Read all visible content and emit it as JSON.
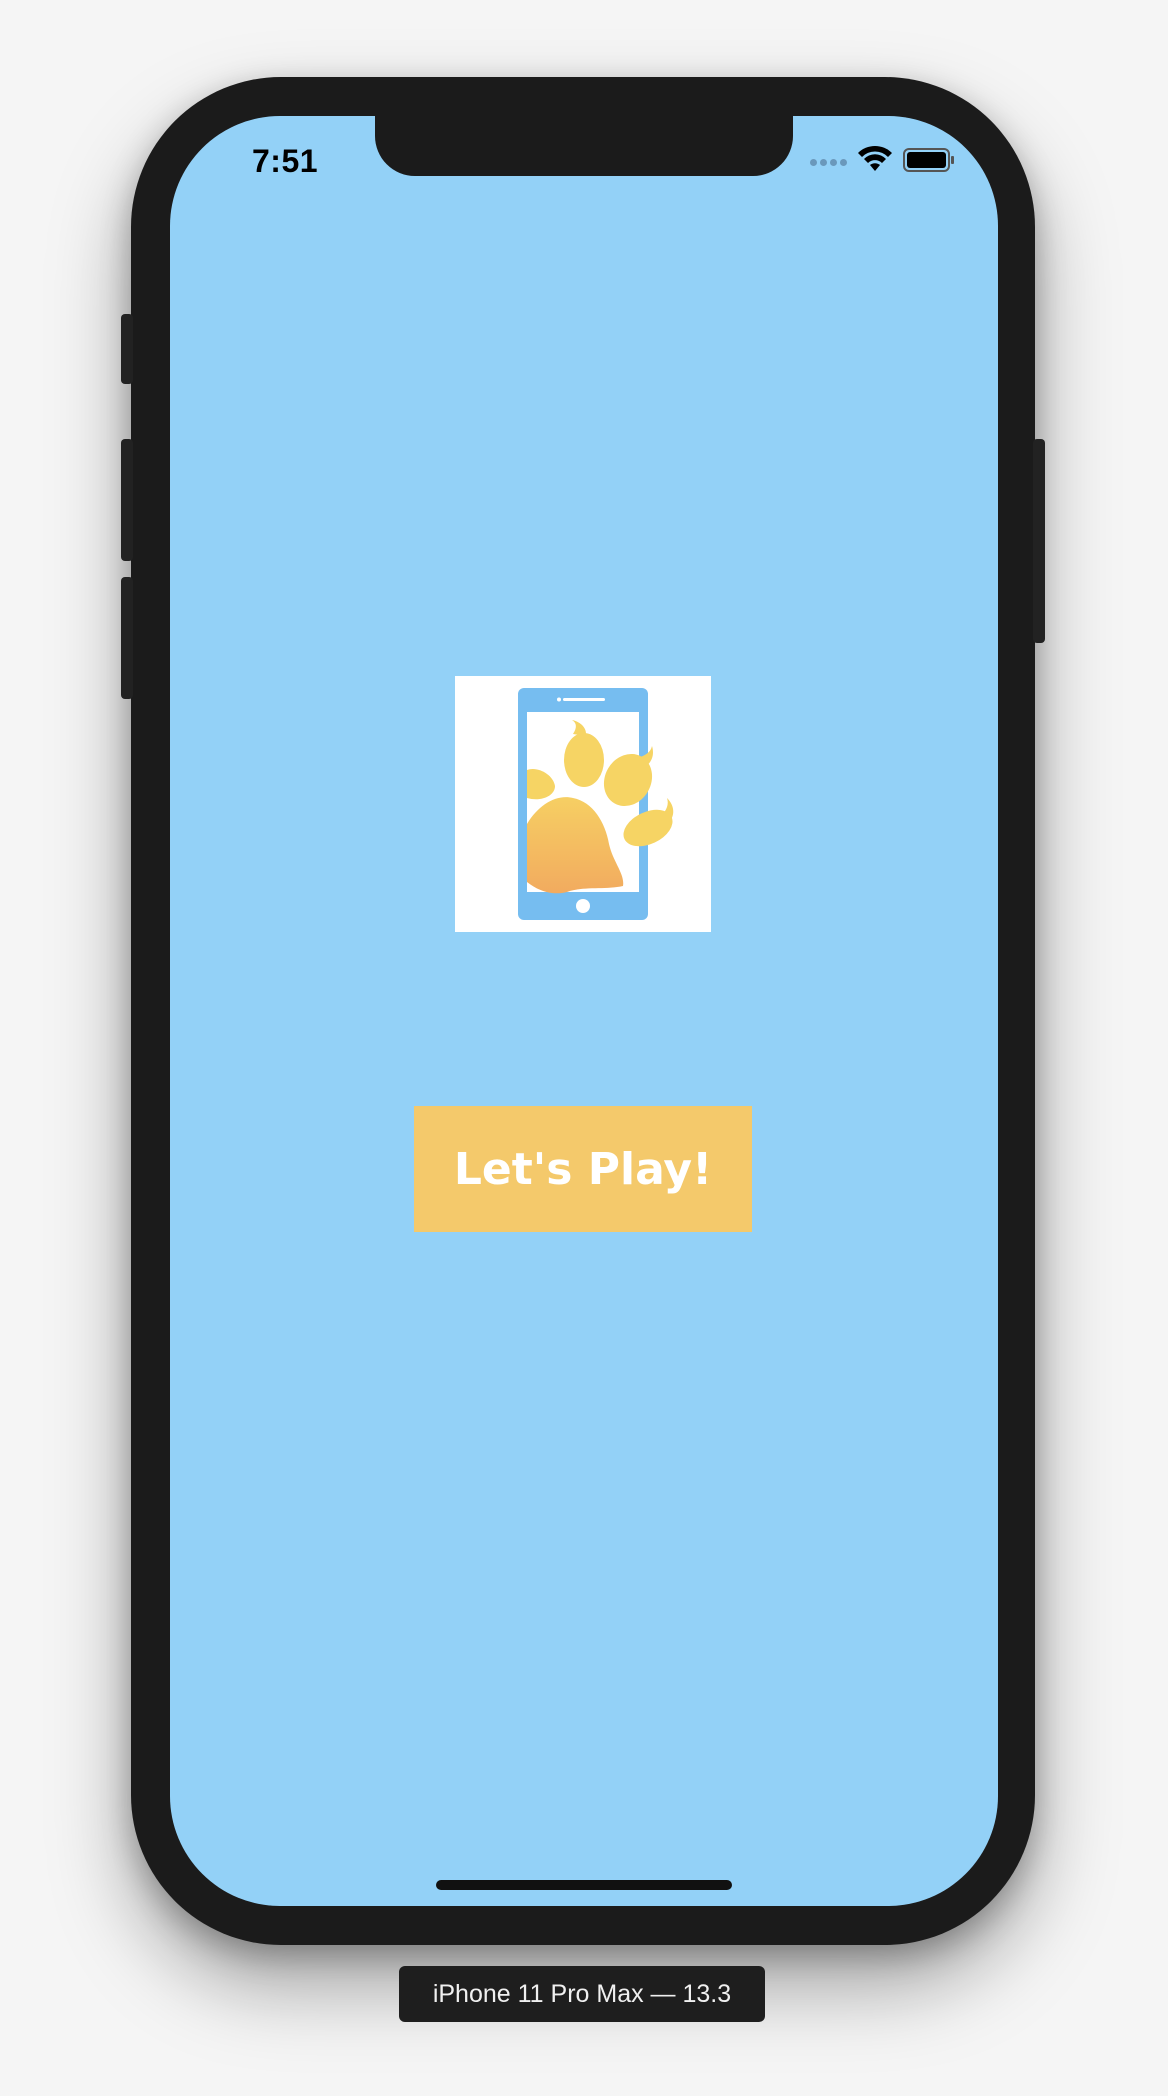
{
  "status_bar": {
    "time": "7:51"
  },
  "app": {
    "play_button_label": "Let's Play!",
    "background_color": "#93d1f7",
    "button_color": "#f4c96b",
    "logo_icon": "phone-paw-icon"
  },
  "simulator": {
    "device_label": "iPhone 11 Pro Max — 13.3"
  }
}
